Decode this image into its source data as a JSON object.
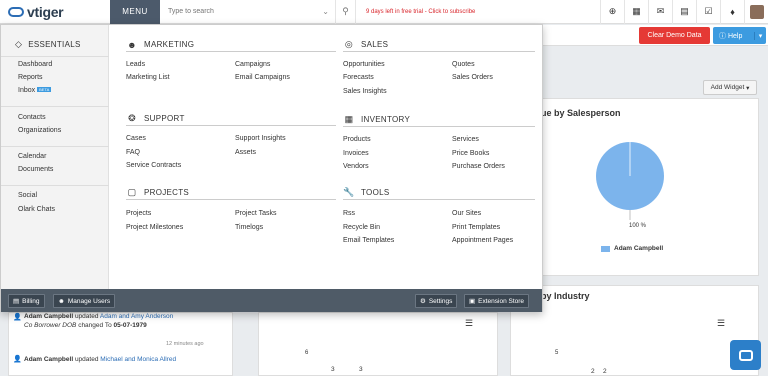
{
  "topbar": {
    "logo_text": "vtiger",
    "menu_label": "MENU",
    "search_placeholder": "Type to search",
    "trial_text": "9 days left in free trial - Click to subscribe"
  },
  "header": {
    "demo_btn": "Clear Demo Data",
    "help_btn": "Help"
  },
  "menu": {
    "essentials": {
      "title": "ESSENTIALS",
      "items": [
        "Dashboard",
        "Reports",
        "Inbox"
      ],
      "beta": "BETA",
      "group2": [
        "Contacts",
        "Organizations"
      ],
      "group3": [
        "Calendar",
        "Documents"
      ],
      "group4": [
        "Social",
        "Olark Chats"
      ]
    },
    "marketing": {
      "title": "MARKETING",
      "items": [
        "Leads",
        "Marketing List",
        "Campaigns",
        "Email Campaigns"
      ]
    },
    "sales": {
      "title": "SALES",
      "items": [
        "Opportunities",
        "Forecasts",
        "Sales Insights",
        "Quotes",
        "Sales Orders"
      ]
    },
    "support": {
      "title": "SUPPORT",
      "items": [
        "Cases",
        "FAQ",
        "Service Contracts",
        "Support Insights",
        "Assets"
      ]
    },
    "inventory": {
      "title": "INVENTORY",
      "items": [
        "Products",
        "Invoices",
        "Vendors",
        "Services",
        "Price Books",
        "Purchase Orders"
      ]
    },
    "projects": {
      "title": "PROJECTS",
      "items": [
        "Projects",
        "Project Milestones",
        "Project Tasks",
        "Timelogs"
      ]
    },
    "tools": {
      "title": "TOOLS",
      "items": [
        "Rss",
        "Recycle Bin",
        "Email Templates",
        "Our Sites",
        "Print Templates",
        "Appointment Pages"
      ]
    },
    "footer": {
      "billing": "Billing",
      "manage_users": "Manage Users",
      "settings": "Settings",
      "extension_store": "Extension Store"
    }
  },
  "dashboard": {
    "add_widget": "Add Widget",
    "sales_widget_title": "ue by Salesperson",
    "chart_data": {
      "type": "pie",
      "slices": [
        {
          "label": "Adam Campbell",
          "value": 100
        }
      ],
      "data_label": "100 %",
      "legend": "Adam Campbell",
      "colors": [
        "#7cb4ec"
      ]
    },
    "industry_widget_title": "by Industry",
    "mid_axis_tick": "6",
    "mid_values": [
      "3",
      "3"
    ],
    "right_axis_tick": "5",
    "right_values": [
      "2",
      "2"
    ],
    "activity": [
      {
        "who": "Adam Campbell",
        "verb": "updated",
        "link": "Adam and Amy Anderson",
        "field": "Co Borrower DOB",
        "changed": "changed To",
        "value": "05-07-1979",
        "ago": "12 minutes ago"
      },
      {
        "who": "Adam Campbell",
        "verb": "updated",
        "link": "Michael and Monica Allred"
      }
    ]
  }
}
